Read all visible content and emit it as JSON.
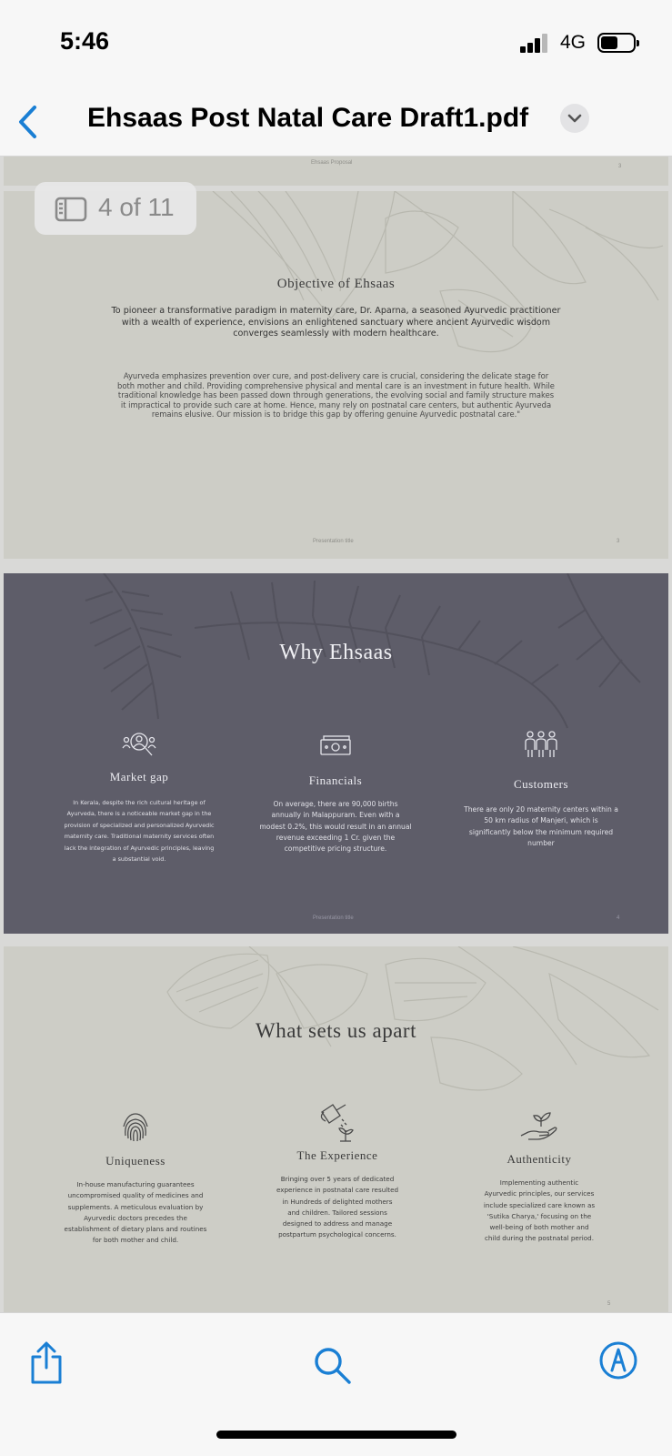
{
  "status_bar": {
    "time": "5:46",
    "network": "4G"
  },
  "nav": {
    "title": "Ehsaas Post Natal Care Draft1.pdf",
    "accent_color": "#1a7fd4"
  },
  "page_indicator": {
    "label": "4 of 11"
  },
  "pages": {
    "prev": {
      "header": "Ehsaas Proposal",
      "number": "3"
    },
    "objective": {
      "title": "Objective of Ehsaas",
      "lead_lines": [
        "To pioneer a transformative paradigm in maternity care, Dr. Aparna, a seasoned Ayurvedic practitioner",
        "with a wealth of experience, envisions an enlightened sanctuary where ancient Ayurvedic wisdom",
        "converges seamlessly with modern healthcare."
      ],
      "body_lines": [
        "Ayurveda emphasizes prevention over cure, and post-delivery care is crucial, considering the delicate stage for",
        "both mother and child. Providing comprehensive physical and mental care is an investment in future health. While",
        "traditional knowledge has been passed down through generations, the evolving social and  family structure makes",
        "it impractical to provide such care at home. Hence, many rely on postnatal care centers, but authentic Ayurveda",
        "remains elusive. Our mission is to bridge this gap by offering genuine Ayurvedic postnatal care.\""
      ],
      "footer": "Presentation title",
      "number": "3"
    },
    "why": {
      "title": "Why Ehsaas",
      "columns": [
        {
          "icon": "market-research-icon",
          "title": "Market gap",
          "lines": [
            "In Kerala, despite the rich cultural heritage of",
            "Ayurveda, there is a noticeable market gap in the",
            "provision of specialized and personalized Ayurvedic",
            "maternity care. Traditional maternity services often",
            "lack the integration of Ayurvedic principles, leaving",
            "a substantial void."
          ]
        },
        {
          "icon": "money-icon",
          "title": "Financials",
          "lines": [
            "On average, there are 90,000 births",
            "annually in Malappuram. Even with a",
            "modest 0.2%, this would result in an annual",
            "revenue exceeding  1 Cr. given the",
            "competitive pricing structure."
          ]
        },
        {
          "icon": "people-group-icon",
          "title": "Customers",
          "lines": [
            "There are only 20 maternity centers within a",
            "50 km radius of Manjeri, which is",
            "significantly below the minimum required",
            "number"
          ]
        }
      ],
      "footer": "Presentation title",
      "number": "4"
    },
    "apart": {
      "title": "What sets us apart",
      "columns": [
        {
          "icon": "fingerprint-icon",
          "title": "Uniqueness",
          "lines": [
            "In-house manufacturing guarantees",
            "uncompromised quality of medicines and",
            "supplements. A meticulous evaluation by",
            "Ayurvedic doctors precedes the",
            "establishment of dietary plans and routines",
            "for both mother and child."
          ]
        },
        {
          "icon": "watering-can-icon",
          "title": "The Experience",
          "lines": [
            "Bringing over 5 years of dedicated",
            "experience in postnatal care resulted",
            "in Hundreds of delighted mothers",
            "and children. Tailored sessions",
            "designed to address and manage",
            "postpartum psychological concerns."
          ]
        },
        {
          "icon": "hand-sprout-icon",
          "title": "Authenticity",
          "lines": [
            "Implementing authentic",
            "Ayurvedic principles, our services",
            "include specialized care known as",
            "'Sutika Charya,' focusing on the",
            "well-being of both mother and",
            "child during the postnatal period."
          ]
        }
      ],
      "number": "5"
    }
  },
  "toolbar": {
    "items": [
      "share-icon",
      "search-icon",
      "markup-icon"
    ]
  }
}
